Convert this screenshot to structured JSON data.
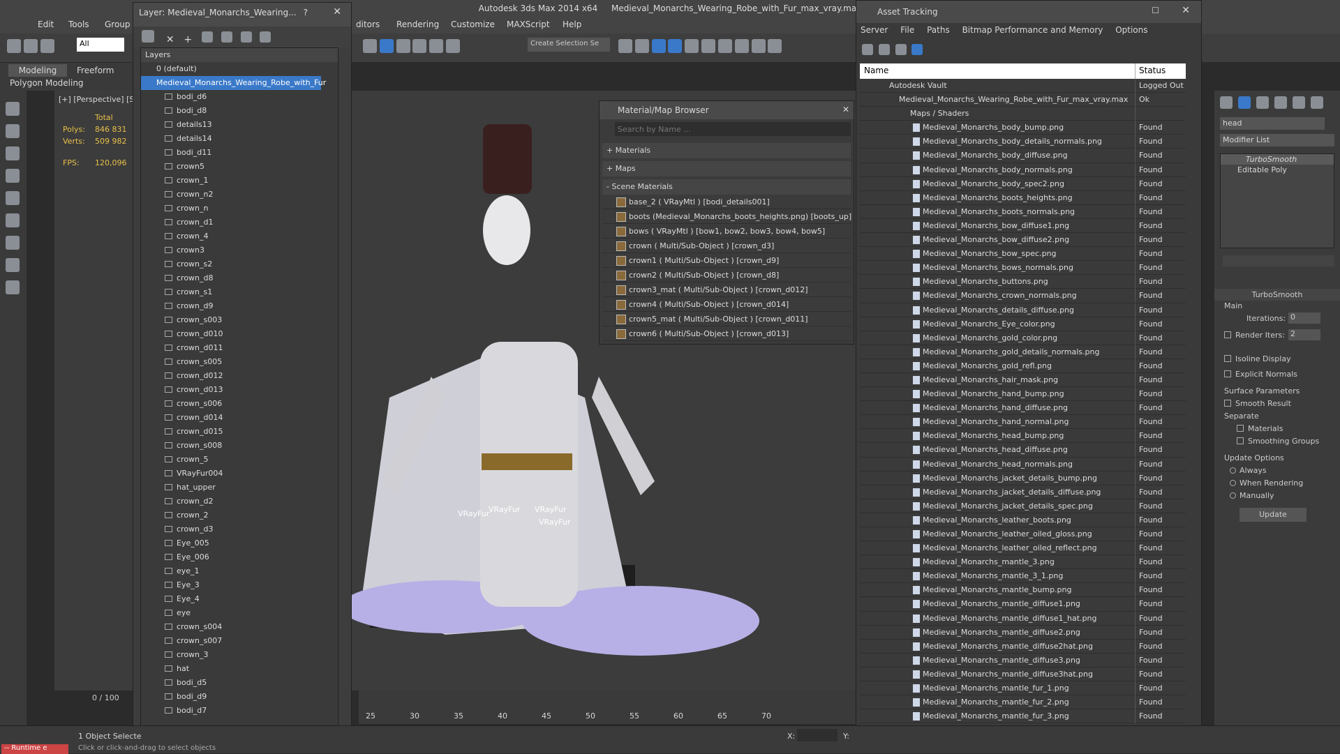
{
  "app": {
    "title": "Autodesk 3ds Max  2014 x64",
    "file": "Medieval_Monarchs_Wearing_Robe_with_Fur_max_vray.max"
  },
  "menu": [
    "Edit",
    "Tools",
    "Group",
    "ditors",
    "Rendering",
    "Customize",
    "MAXScript",
    "Help"
  ],
  "toolbar": {
    "selection_filter": "All",
    "selection_set": "Create Selection Se"
  },
  "ribbon": {
    "tabs": [
      "Modeling",
      "Freeform"
    ],
    "sub": "Polygon Modeling"
  },
  "viewport": {
    "label": "[+] [Perspective] [S",
    "stats": {
      "total": "Total",
      "polys_label": "Polys:",
      "polys": "846 831",
      "verts_label": "Verts:",
      "verts": "509 982",
      "fps_label": "FPS:",
      "fps": "120,096"
    },
    "fur_labels": [
      "VRayFur",
      "VRayFur",
      "VRayFur",
      "VRayFur"
    ]
  },
  "layer_manager": {
    "title": "Layer: Medieval_Monarchs_Wearing...",
    "header": "Layers",
    "default_layer": "0 (default)",
    "active_layer": "Medieval_Monarchs_Wearing_Robe_with_Fur",
    "items": [
      "bodi_d6",
      "bodi_d8",
      "details13",
      "details14",
      "bodi_d11",
      "crown5",
      "crown_1",
      "crown_n2",
      "crown_n",
      "crown_d1",
      "crown_4",
      "crown3",
      "crown_s2",
      "crown_d8",
      "crown_s1",
      "crown_d9",
      "crown_s003",
      "crown_d010",
      "crown_d011",
      "crown_s005",
      "crown_d012",
      "crown_d013",
      "crown_s006",
      "crown_d014",
      "crown_d015",
      "crown_s008",
      "crown_5",
      "VRayFur004",
      "hat_upper",
      "crown_d2",
      "crown_2",
      "crown_d3",
      "Eye_005",
      "Eye_006",
      "eye_1",
      "Eye_3",
      "Eye_4",
      "eye",
      "crown_s004",
      "crown_s007",
      "crown_3",
      "hat",
      "bodi_d5",
      "bodi_d9",
      "bodi_d7"
    ]
  },
  "material_browser": {
    "title": "Material/Map Browser",
    "search_placeholder": "Search by Name ...",
    "groups": [
      "+ Materials",
      "+ Maps",
      "- Scene Materials"
    ],
    "items": [
      "base_2  ( VRayMtl ) [bodi_details001]",
      "boots (Medieval_Monarchs_boots_heights.png) [boots_up]",
      "bows  ( VRayMtl ) [bow1, bow2, bow3, bow4, bow5]",
      "crown  ( Multi/Sub-Object ) [crown_d3]",
      "crown1  ( Multi/Sub-Object ) [crown_d9]",
      "crown2  ( Multi/Sub-Object ) [crown_d8]",
      "crown3_mat  ( Multi/Sub-Object ) [crown_d012]",
      "crown4  ( Multi/Sub-Object ) [crown_d014]",
      "crown5_mat  ( Multi/Sub-Object ) [crown_d011]",
      "crown6  ( Multi/Sub-Object ) [crown_d013]"
    ]
  },
  "asset_tracking": {
    "title": "Asset Tracking",
    "menu": [
      "Server",
      "File",
      "Paths",
      "Bitmap Performance and Memory",
      "Options"
    ],
    "col_name": "Name",
    "col_status": "Status",
    "vault": "Autodesk Vault",
    "vault_status": "Logged Out ...",
    "file": "Medieval_Monarchs_Wearing_Robe_with_Fur_max_vray.max",
    "file_status": "Ok",
    "maps_folder": "Maps / Shaders",
    "found": "Found",
    "maps": [
      "Medieval_Monarchs_body_bump.png",
      "Medieval_Monarchs_body_details_normals.png",
      "Medieval_Monarchs_body_diffuse.png",
      "Medieval_Monarchs_body_normals.png",
      "Medieval_Monarchs_body_spec2.png",
      "Medieval_Monarchs_boots_heights.png",
      "Medieval_Monarchs_boots_normals.png",
      "Medieval_Monarchs_bow_diffuse1.png",
      "Medieval_Monarchs_bow_diffuse2.png",
      "Medieval_Monarchs_bow_spec.png",
      "Medieval_Monarchs_bows_normals.png",
      "Medieval_Monarchs_buttons.png",
      "Medieval_Monarchs_crown_normals.png",
      "Medieval_Monarchs_details_diffuse.png",
      "Medieval_Monarchs_Eye_color.png",
      "Medieval_Monarchs_gold_color.png",
      "Medieval_Monarchs_gold_details_normals.png",
      "Medieval_Monarchs_gold_refl.png",
      "Medieval_Monarchs_hair_mask.png",
      "Medieval_Monarchs_hand_bump.png",
      "Medieval_Monarchs_hand_diffuse.png",
      "Medieval_Monarchs_hand_normal.png",
      "Medieval_Monarchs_head_bump.png",
      "Medieval_Monarchs_head_diffuse.png",
      "Medieval_Monarchs_head_normals.png",
      "Medieval_Monarchs_jacket_details_bump.png",
      "Medieval_Monarchs_jacket_details_diffuse.png",
      "Medieval_Monarchs_jacket_details_spec.png",
      "Medieval_Monarchs_leather_boots.png",
      "Medieval_Monarchs_leather_oiled_gloss.png",
      "Medieval_Monarchs_leather_oiled_reflect.png",
      "Medieval_Monarchs_mantle_3.png",
      "Medieval_Monarchs_mantle_3_1.png",
      "Medieval_Monarchs_mantle_bump.png",
      "Medieval_Monarchs_mantle_diffuse1.png",
      "Medieval_Monarchs_mantle_diffuse1_hat.png",
      "Medieval_Monarchs_mantle_diffuse2.png",
      "Medieval_Monarchs_mantle_diffuse2hat.png",
      "Medieval_Monarchs_mantle_diffuse3.png",
      "Medieval_Monarchs_mantle_diffuse3hat.png",
      "Medieval_Monarchs_mantle_fur_1.png",
      "Medieval_Monarchs_mantle_fur_2.png",
      "Medieval_Monarchs_mantle_fur_3.png"
    ]
  },
  "modifier_panel": {
    "name_field": "head",
    "modifier_list": "Modifier List",
    "stack": [
      "TurboSmooth",
      "Editable Poly"
    ],
    "rollout": "TurboSmooth",
    "main": "Main",
    "iterations_label": "Iterations:",
    "iterations": "0",
    "render_iters_label": "Render Iters:",
    "render_iters": "2",
    "isoline": "Isoline Display",
    "explicit": "Explicit Normals",
    "surface": "Surface Parameters",
    "smooth": "Smooth Result",
    "separate": "Separate",
    "materials": "Materials",
    "smoothing_groups": "Smoothing Groups",
    "update_options": "Update Options",
    "always": "Always",
    "when_rendering": "When Rendering",
    "manually": "Manually",
    "update": "Update"
  },
  "timeline": {
    "frame": "0 / 100",
    "ticks": [
      "25",
      "30",
      "35",
      "40",
      "45",
      "50",
      "55",
      "60",
      "65",
      "70"
    ]
  },
  "status": {
    "selected": "1 Object Selecte",
    "hint": "Click or click-and-drag to select objects",
    "script": "-- Runtime e",
    "x_label": "X:",
    "y_label": "Y:"
  },
  "colors": {
    "accent": "#3a79c9",
    "fur": "#c8c8ff",
    "cloak": "#b9b9c9"
  }
}
